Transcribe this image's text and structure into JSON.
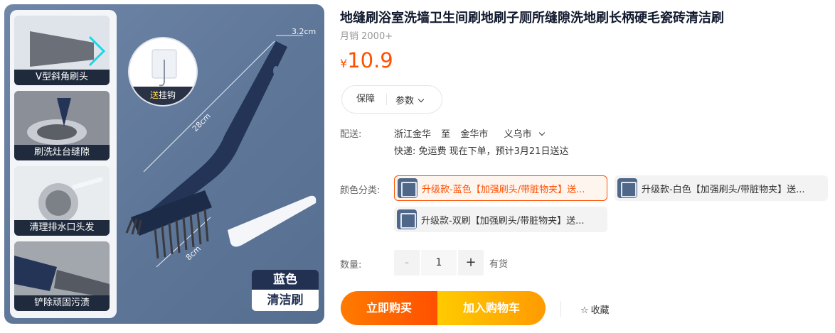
{
  "gallery": {
    "thumbnails": [
      {
        "caption": "V型斜角刷头"
      },
      {
        "caption": "刷洗灶台缝隙"
      },
      {
        "caption": "清理排水口头发"
      },
      {
        "caption": "铲除顽固污渍"
      }
    ],
    "hook_badge": {
      "highlight": "送",
      "text": "挂钩"
    },
    "dimensions": {
      "width": "3.2cm",
      "length": "28cm",
      "head": "8cm"
    },
    "color_tag": {
      "line1": "蓝色",
      "line2": "清洁刷"
    },
    "colors": {
      "background": "#5e7698",
      "brush": "#233457",
      "accent": "#ffd84a"
    }
  },
  "product": {
    "title": "地缝刷浴室洗墙卫生间刷地刷子厕所缝隙洗地刷长柄硬毛瓷砖清洁刷",
    "sales": "月销 2000+",
    "currency": "¥",
    "price": "10.9",
    "price_color": "#ff4f00"
  },
  "tabs": {
    "guarantee": "保障",
    "params": "参数"
  },
  "shipping": {
    "label": "配送:",
    "from": "浙江金华",
    "to_word": "至",
    "to_city": "金华市",
    "to_district": "义乌市",
    "detail": "快递: 免运费  现在下单，预计3月21日送达"
  },
  "variants": {
    "label": "颜色分类:",
    "options": [
      {
        "text": "升级款-蓝色【加强刷头/带脏物夹】送...",
        "selected": true
      },
      {
        "text": "升级款-白色【加强刷头/带脏物夹】送...",
        "selected": false
      },
      {
        "text": "升级款-双刷【加强刷头/带脏物夹】送...",
        "selected": false
      }
    ]
  },
  "quantity": {
    "label": "数量:",
    "minus": "-",
    "value": "1",
    "plus": "+",
    "stock": "有货"
  },
  "actions": {
    "buy_now": "立即购买",
    "add_cart": "加入购物车",
    "favorite": "收藏",
    "buy_color": "#ff5000",
    "cart_color": "#ffa800"
  }
}
